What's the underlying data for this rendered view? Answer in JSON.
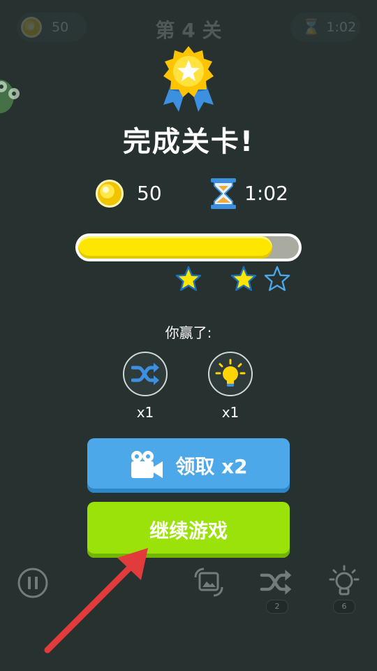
{
  "hud": {
    "coins": "50",
    "level_title": "第 4 关",
    "timer": "1:02"
  },
  "dialog": {
    "title": "完成关卡!",
    "coins": "50",
    "time": "1:02",
    "progress": 0.88,
    "stars_earned": 2,
    "stars_total": 3,
    "won_label": "你赢了:",
    "rewards": [
      {
        "icon": "shuffle-icon",
        "count": "x1"
      },
      {
        "icon": "lightbulb-icon",
        "count": "x1"
      }
    ],
    "claim_button": "领取 x2",
    "continue_button": "继续游戏"
  },
  "bottom_bar": {
    "shuffle_badge": "2",
    "hint_badge": "6"
  },
  "colors": {
    "background": "#263130",
    "claim_button": "#4da8ea",
    "continue_button": "#9be10a",
    "progress_fill": "#ffe600",
    "arrow": "#e23b3b"
  }
}
